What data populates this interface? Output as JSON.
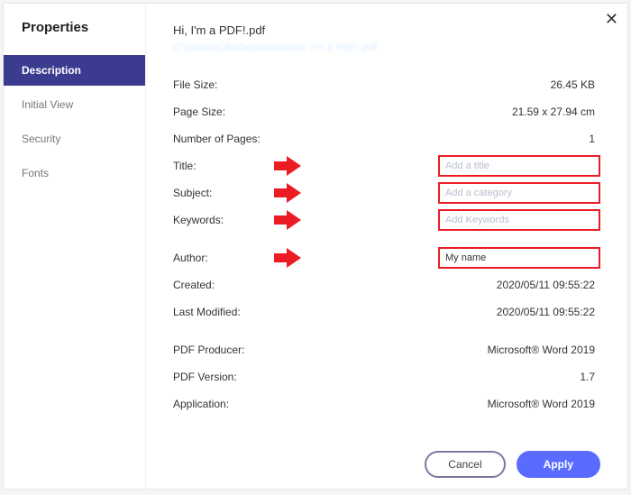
{
  "sidebar": {
    "title": "Properties",
    "items": [
      {
        "label": "Description",
        "active": true
      },
      {
        "label": "Initial View",
        "active": false
      },
      {
        "label": "Security",
        "active": false
      },
      {
        "label": "Fonts",
        "active": false
      }
    ]
  },
  "header": {
    "file_name": "Hi, I'm a PDF!.pdf",
    "file_path_blurred": "C:\\Users\\Cde\\Documents\\Hi, I'm a PDF!.pdf"
  },
  "props": {
    "file_size": {
      "label": "File Size:",
      "value": "26.45 KB"
    },
    "page_size": {
      "label": "Page Size:",
      "value": "21.59 x 27.94 cm"
    },
    "num_pages": {
      "label": "Number of Pages:",
      "value": "1"
    },
    "title": {
      "label": "Title:",
      "placeholder": "Add a title",
      "value": ""
    },
    "subject": {
      "label": "Subject:",
      "placeholder": "Add a category",
      "value": ""
    },
    "keywords": {
      "label": "Keywords:",
      "placeholder": "Add Keywords",
      "value": ""
    },
    "author": {
      "label": "Author:",
      "placeholder": "",
      "value": "My name"
    },
    "created": {
      "label": "Created:",
      "value": "2020/05/11 09:55:22"
    },
    "modified": {
      "label": "Last Modified:",
      "value": "2020/05/11 09:55:22"
    },
    "producer": {
      "label": "PDF Producer:",
      "value": "Microsoft® Word 2019"
    },
    "version": {
      "label": "PDF Version:",
      "value": "1.7"
    },
    "application": {
      "label": "Application:",
      "value": "Microsoft® Word 2019"
    }
  },
  "buttons": {
    "cancel": "Cancel",
    "apply": "Apply"
  },
  "colors": {
    "accent": "#5a6cff",
    "sidebar_active": "#3b3b8f",
    "highlight_red": "#ec1c24"
  }
}
